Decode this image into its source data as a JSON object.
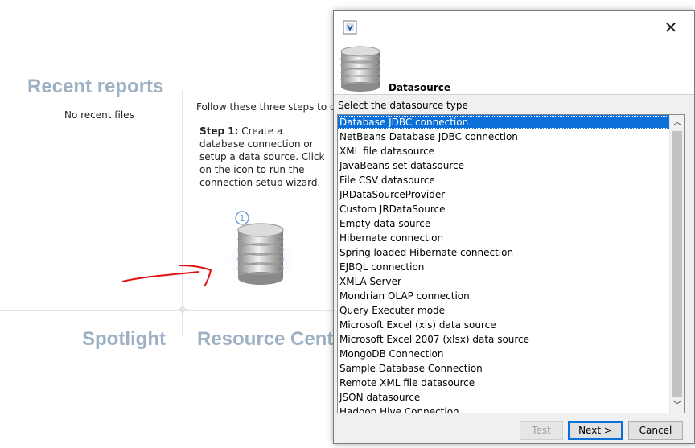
{
  "background": {
    "recent_reports_heading": "Recent reports",
    "no_recent_files": "No recent files",
    "intro_text": "Follow these three steps to cr",
    "step_label": "Step 1:",
    "step_description": "Create a database connection or setup a data source. Click on the icon to run the connection setup wizard.",
    "step_number_icon": "circled-one-icon",
    "spotlight_heading": "Spotlight",
    "resource_center_heading": "Resource Cent"
  },
  "dialog": {
    "app_icon": "jasper-app-icon",
    "close_label": "✕",
    "header_title": "Datasource",
    "prompt": "Select the datasource type",
    "items": [
      "Database JDBC connection",
      "NetBeans Database JDBC connection",
      "XML file datasource",
      "JavaBeans set datasource",
      "File CSV datasource",
      "JRDataSourceProvider",
      "Custom JRDataSource",
      "Empty data source",
      "Hibernate connection",
      "Spring loaded Hibernate connection",
      "EJBQL connection",
      "XMLA Server",
      "Mondrian OLAP connection",
      "Query Executer mode",
      "Microsoft Excel (xls) data source",
      "Microsoft Excel 2007 (xlsx) data source",
      "MongoDB Connection",
      "Sample Database Connection",
      "Remote XML file datasource",
      "JSON datasource",
      "Hadoop Hive Connection"
    ],
    "selected_index": 0,
    "buttons": {
      "test": "Test",
      "next": "Next >",
      "cancel": "Cancel"
    }
  },
  "colors": {
    "heading": "#9db0c4",
    "selection": "#0a6fd8",
    "annotation_arrow": "#e01010"
  }
}
